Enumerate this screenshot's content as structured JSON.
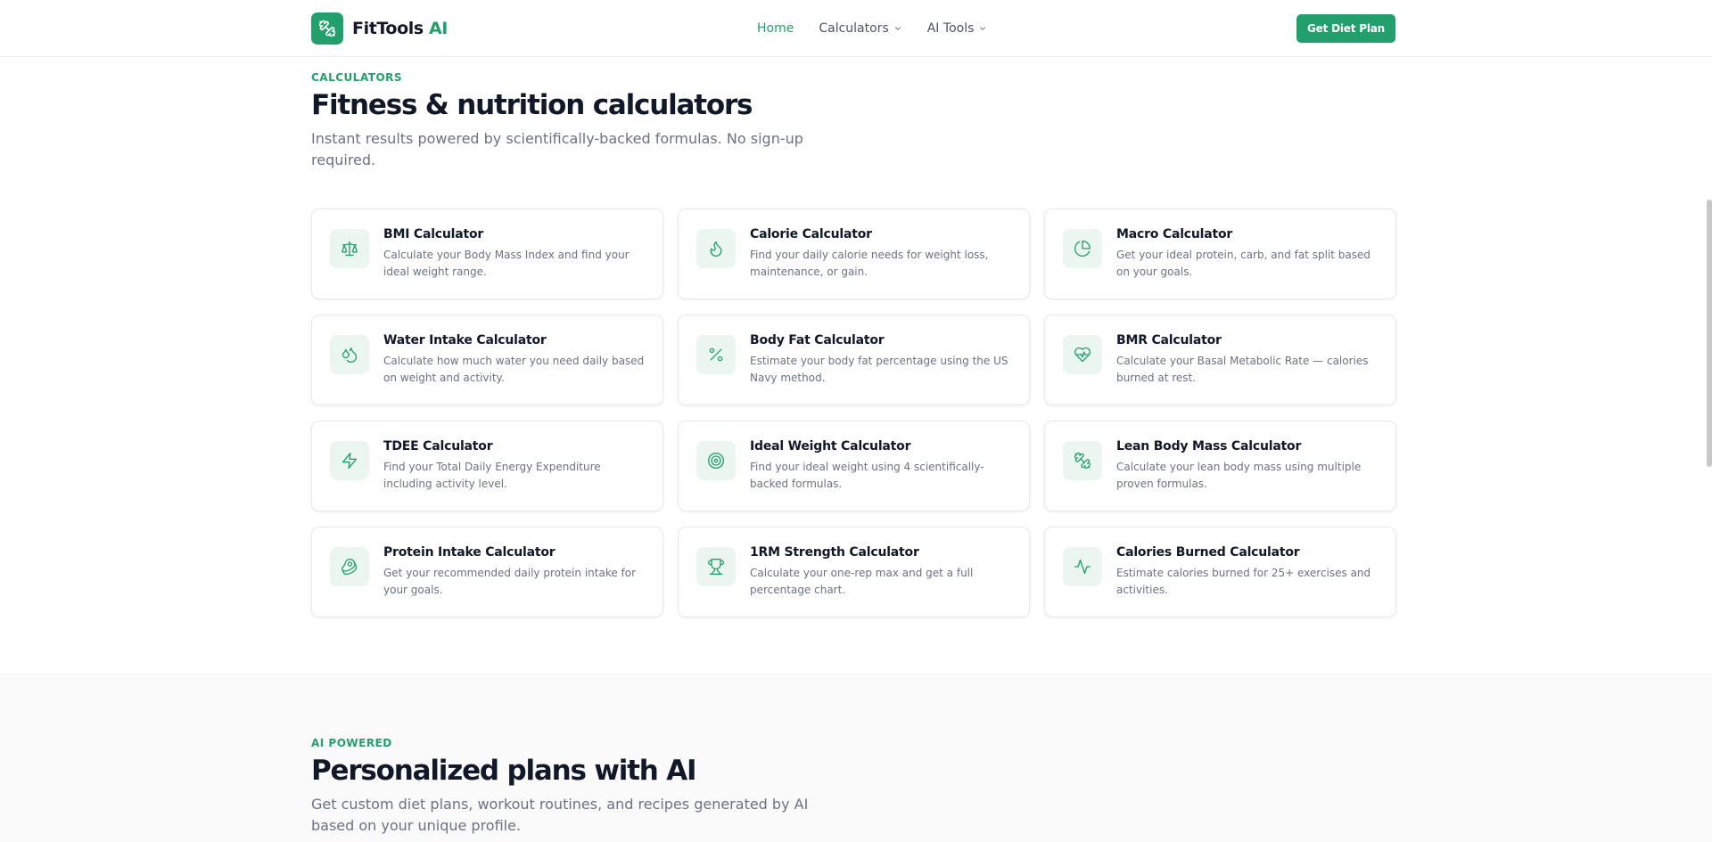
{
  "header": {
    "logo_main": "FitTools",
    "logo_accent": "AI",
    "nav": [
      {
        "label": "Home"
      },
      {
        "label": "Calculators"
      },
      {
        "label": "AI Tools"
      }
    ],
    "cta_label": "Get Diet Plan"
  },
  "calculators": {
    "eyebrow": "CALCULATORS",
    "title": "Fitness & nutrition calculators",
    "subtitle": "Instant results powered by scientifically-backed formulas. No sign-up required.",
    "cards": [
      {
        "title": "BMI Calculator",
        "desc": "Calculate your Body Mass Index and find your ideal weight range.",
        "icon": "scale-icon"
      },
      {
        "title": "Calorie Calculator",
        "desc": "Find your daily calorie needs for weight loss, maintenance, or gain.",
        "icon": "flame-icon"
      },
      {
        "title": "Macro Calculator",
        "desc": "Get your ideal protein, carb, and fat split based on your goals.",
        "icon": "pie-chart-icon"
      },
      {
        "title": "Water Intake Calculator",
        "desc": "Calculate how much water you need daily based on weight and activity.",
        "icon": "droplets-icon"
      },
      {
        "title": "Body Fat Calculator",
        "desc": "Estimate your body fat percentage using the US Navy method.",
        "icon": "percent-icon"
      },
      {
        "title": "BMR Calculator",
        "desc": "Calculate your Basal Metabolic Rate — calories burned at rest.",
        "icon": "heart-pulse-icon"
      },
      {
        "title": "TDEE Calculator",
        "desc": "Find your Total Daily Energy Expenditure including activity level.",
        "icon": "zap-icon"
      },
      {
        "title": "Ideal Weight Calculator",
        "desc": "Find your ideal weight using 4 scientifically-backed formulas.",
        "icon": "target-icon"
      },
      {
        "title": "Lean Body Mass Calculator",
        "desc": "Calculate your lean body mass using multiple proven formulas.",
        "icon": "dumbbell-icon"
      },
      {
        "title": "Protein Intake Calculator",
        "desc": "Get your recommended daily protein intake for your goals.",
        "icon": "beef-icon"
      },
      {
        "title": "1RM Strength Calculator",
        "desc": "Calculate your one-rep max and get a full percentage chart.",
        "icon": "trophy-icon"
      },
      {
        "title": "Calories Burned Calculator",
        "desc": "Estimate calories burned for 25+ exercises and activities.",
        "icon": "activity-icon"
      }
    ]
  },
  "ai_section": {
    "eyebrow": "AI POWERED",
    "title": "Personalized plans with AI",
    "subtitle": "Get custom diet plans, workout routines, and recipes generated by AI based on your unique profile."
  },
  "colors": {
    "accent": "#22a06b",
    "icon_bg": "#ecf6f1",
    "text": "#111827",
    "muted": "#6b7280"
  }
}
